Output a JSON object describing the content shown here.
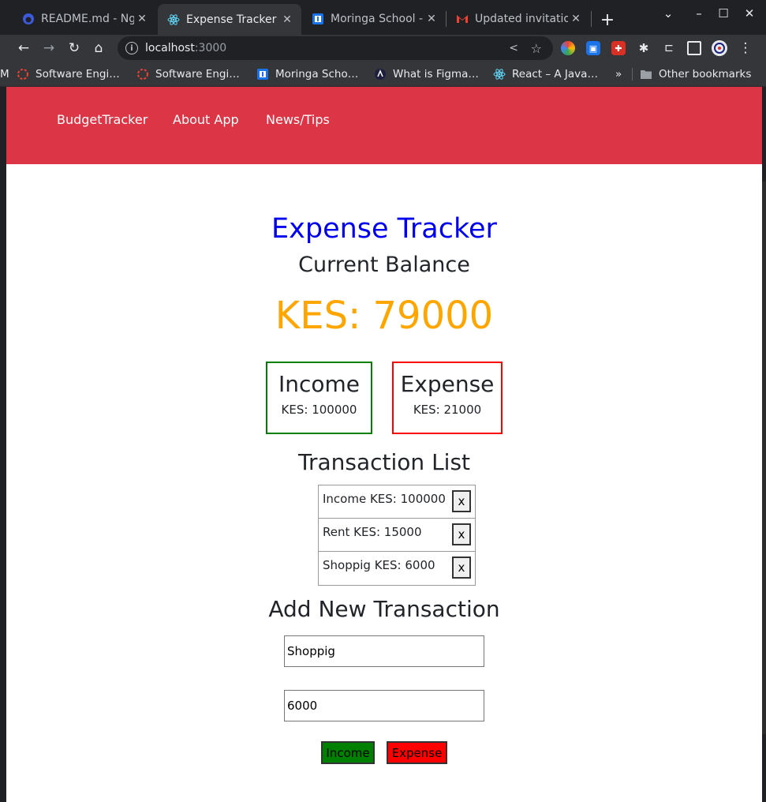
{
  "browser": {
    "tabs": [
      {
        "title": "README.md - Ng",
        "active": false,
        "icon": "github-icon"
      },
      {
        "title": "Expense Tracker",
        "active": true,
        "icon": "react-icon"
      },
      {
        "title": "Moringa School -",
        "active": false,
        "icon": "moringa-icon"
      },
      {
        "title": "Updated invitatio",
        "active": false,
        "icon": "gmail-icon"
      }
    ],
    "url_host": "localhost",
    "url_port": ":3000",
    "bookmarks": [
      {
        "label": "Software Engi…",
        "icon": "red-ring-icon"
      },
      {
        "label": "Software Engi…",
        "icon": "red-ring-icon"
      },
      {
        "label": "Moringa Scho…",
        "icon": "moringa-icon"
      },
      {
        "label": "What is Figma…",
        "icon": "figma-icon"
      },
      {
        "label": "React – A Java…",
        "icon": "react-icon"
      }
    ],
    "more_bookmarks": "»",
    "other_bookmarks": "Other bookmarks"
  },
  "nav": {
    "brand": "BudgetTracker",
    "about": "About App",
    "news": "News/Tips"
  },
  "app": {
    "title": "Expense Tracker",
    "balance_label": "Current Balance",
    "balance": "KES: 79000",
    "income_label": "Income",
    "income_value": "KES: 100000",
    "expense_label": "Expense",
    "expense_value": "KES: 21000",
    "tx_heading": "Transaction List",
    "transactions": [
      {
        "text": "Income KES: 100000",
        "delete": "x"
      },
      {
        "text": "Rent KES: 15000",
        "delete": "x"
      },
      {
        "text": "Shoppig KES: 6000",
        "delete": "x"
      }
    ],
    "add_heading": "Add New Transaction",
    "name_value": "Shoppig",
    "amount_value": "6000",
    "income_button": "Income",
    "expense_button": "Expense"
  },
  "colors": {
    "navbar": "#dc3545",
    "title": "#0000ee",
    "balance": "#ffa500",
    "income": "#008000",
    "expense": "#ff0000"
  }
}
